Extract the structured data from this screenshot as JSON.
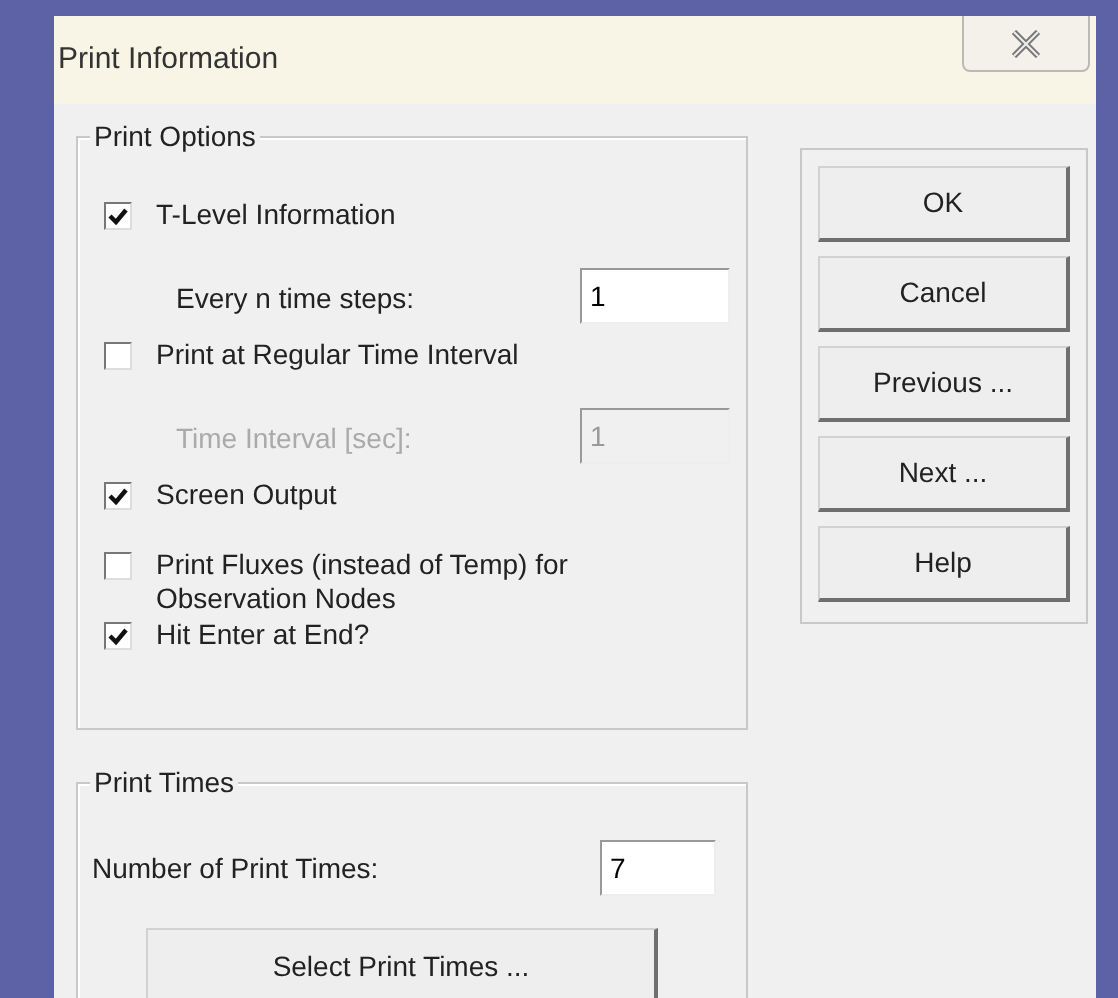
{
  "window": {
    "title": "Print Information"
  },
  "print_options": {
    "legend": "Print Options",
    "items": [
      {
        "kind": "checkbox",
        "label": "T-Level Information",
        "checked": true
      },
      {
        "kind": "field",
        "label": "Every n time steps:",
        "value": "1",
        "disabled": false
      },
      {
        "kind": "checkbox",
        "label": "Print at Regular Time Interval",
        "checked": false
      },
      {
        "kind": "field",
        "label": "Time Interval [sec]:",
        "value": "1",
        "disabled": true
      },
      {
        "kind": "checkbox",
        "label": "Screen Output",
        "checked": true
      },
      {
        "kind": "checkbox",
        "label": "Print Fluxes (instead of Temp) for Observation Nodes",
        "checked": false
      },
      {
        "kind": "checkbox",
        "label": "Hit Enter at End?",
        "checked": true
      }
    ]
  },
  "print_times": {
    "legend": "Print Times",
    "field": {
      "label": "Number of Print Times:",
      "value": "7"
    },
    "button": "Select Print Times ..."
  },
  "buttons": [
    "OK",
    "Cancel",
    "Previous ...",
    "Next ...",
    "Help"
  ]
}
